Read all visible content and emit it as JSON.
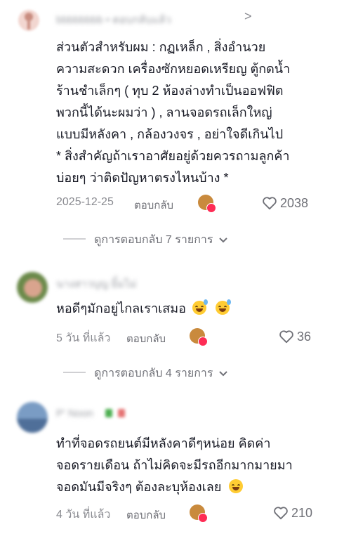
{
  "comments": [
    {
      "username": "bbbbbbbb • ตอบกลับแล้ว",
      "chevron": ">",
      "lines": [
        "ส่วนตัวสำหรับผม : กฏเหล็ก , สิ่งอำนวย",
        "ความสะดวก เครื่องซักหยอดเหรียญ ตู้กดน้ำ",
        "ร้านชำเล็กๆ ( ทุบ 2 ห้องล่างทำเป็นออฟฟิต",
        "พวกนี้ได้นะผมว่า ) , ลานจอดรถเล็กใหญ่",
        "แบบมีหลังคา , กล้องวงจร , อย่าใจดีเกินไป",
        "* สิ่งสำคัญถ้าเราอาศัยอยู่ด้วยควรถามลูกค้า",
        "บ่อยๆ ว่าติดปัญหาตรงไหนบ้าง *"
      ],
      "date": "2025-12-25",
      "reply_label": "ตอบกลับ",
      "likes": "2038",
      "view_replies": "ดูการตอบกลับ 7 รายการ"
    },
    {
      "username": "นางสาวบุญ ยิ้มไม่",
      "lines": [
        "หอดีๆมักอยู่ไกลเราเสมอ"
      ],
      "date": "5 วัน ที่แล้ว",
      "reply_label": "ตอบกลับ",
      "likes": "36",
      "view_replies": "ดูการตอบกลับ 4 รายการ"
    },
    {
      "username": "P' Noon",
      "lines": [
        "ทำที่จอดรถยนต์มีหลังคาดีๆหน่อย คิดค่า",
        "จอดรายเดือน ถ้าไม่คิดจะมีรถอีกมากมายมา",
        "จอดมันมีจริงๆ ต้องละบุห้องเลย"
      ],
      "date": "4 วัน ที่แล้ว",
      "reply_label": "ตอบกลับ",
      "likes": "210"
    }
  ],
  "colors": {
    "text": "#161823",
    "meta": "#8a8b91",
    "accent": "#fe2c55"
  },
  "icons": [
    "heart-outline-icon",
    "chevron-down-icon",
    "creator-liked-badge-icon",
    "sweat-smile-emoji",
    "laughing-emoji"
  ]
}
